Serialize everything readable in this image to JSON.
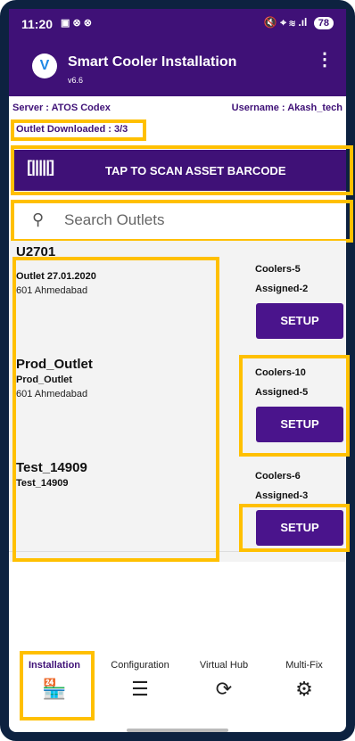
{
  "status": {
    "time": "11:20",
    "battery": "78",
    "left_icons": "▣ ⊗ ⊗",
    "right_icons": "🔇 ⌖ ≋ .ıl"
  },
  "app": {
    "title": "Smart Cooler Installation",
    "version": "v6.6",
    "logo": "V"
  },
  "info": {
    "server": "Server : ATOS Codex",
    "username": "Username : Akash_tech",
    "downloaded": "Outlet Downloaded : 3/3"
  },
  "scan": {
    "icon": "[|||||]",
    "label": "TAP TO SCAN ASSET BARCODE"
  },
  "search": {
    "placeholder": "Search Outlets"
  },
  "outlets": [
    {
      "name": "U2701",
      "sub": "Outlet 27.01.2020",
      "city": "601 Ahmedabad",
      "coolers": "Coolers-5",
      "assigned": "Assigned-2",
      "button": "SETUP"
    },
    {
      "name": "Prod_Outlet",
      "sub": "Prod_Outlet",
      "city": "601 Ahmedabad",
      "coolers": "Coolers-10",
      "assigned": "Assigned-5",
      "button": "SETUP"
    },
    {
      "name": "Test_14909",
      "sub": "Test_14909",
      "city": "",
      "coolers": "Coolers-6",
      "assigned": "Assigned-3",
      "button": "SETUP"
    }
  ],
  "nav": [
    {
      "label": "Installation",
      "icon": "store-icon",
      "glyph": "🏪"
    },
    {
      "label": "Configuration",
      "icon": "list-icon",
      "glyph": "☰"
    },
    {
      "label": "Virtual Hub",
      "icon": "sync-icon",
      "glyph": "⟳"
    },
    {
      "label": "Multi-Fix",
      "icon": "repair-icon",
      "glyph": "⚙"
    }
  ],
  "colors": {
    "primary": "#3f1177",
    "button": "#4a148c",
    "highlight": "#ffc000",
    "frame": "#0d2240"
  }
}
